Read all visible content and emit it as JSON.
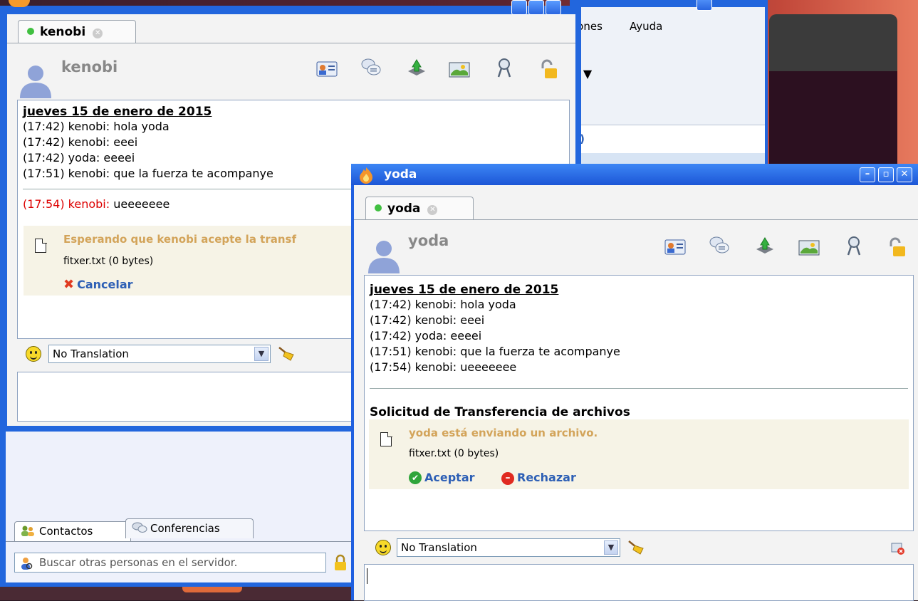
{
  "main_window": {
    "menu": [
      "iones",
      "Ayuda"
    ],
    "fragment": "a)"
  },
  "kenobi_window": {
    "tab_label": "kenobi",
    "contact_name": "kenobi",
    "chat": {
      "date": "jueves 15 de enero de 2015",
      "messages": [
        "(17:42) kenobi: hola yoda",
        "(17:42) kenobi: eeei",
        "(17:42) yoda: eeeei",
        "(17:51) kenobi: que la fuerza te acompanye"
      ],
      "pending": "(17:54) kenobi: ueeeeeee"
    },
    "transfer": {
      "status": "Esperando que kenobi acepte la transf",
      "file": "fitxer.txt (0 bytes)",
      "cancel_label": "Cancelar"
    },
    "translation": "No Translation"
  },
  "contacts_panel": {
    "tabs": [
      "Contactos",
      "Conferencias"
    ],
    "search_placeholder": "Buscar otras personas en el servidor."
  },
  "yoda_window": {
    "title": "yoda",
    "tab_label": "yoda",
    "contact_name": "yoda",
    "chat": {
      "date": "jueves 15 de enero de 2015",
      "messages": [
        "(17:42) kenobi: hola yoda",
        "(17:42) kenobi: eeei",
        "(17:42) yoda: eeeei",
        "(17:51) kenobi: que la fuerza te acompanye",
        "(17:54) kenobi: ueeeeeee"
      ]
    },
    "transfer_heading": "Solicitud de Transferencia de archivos",
    "transfer": {
      "status": "yoda está enviando un archivo.",
      "file": "fitxer.txt (0 bytes)",
      "accept_label": "Aceptar",
      "reject_label": "Rechazar"
    },
    "translation": "No Translation"
  },
  "icons": {
    "toolbar": [
      "contact-card-icon",
      "chat-bubbles-icon",
      "send-file-icon",
      "image-icon",
      "screenshot-icon",
      "lock-icon"
    ]
  }
}
